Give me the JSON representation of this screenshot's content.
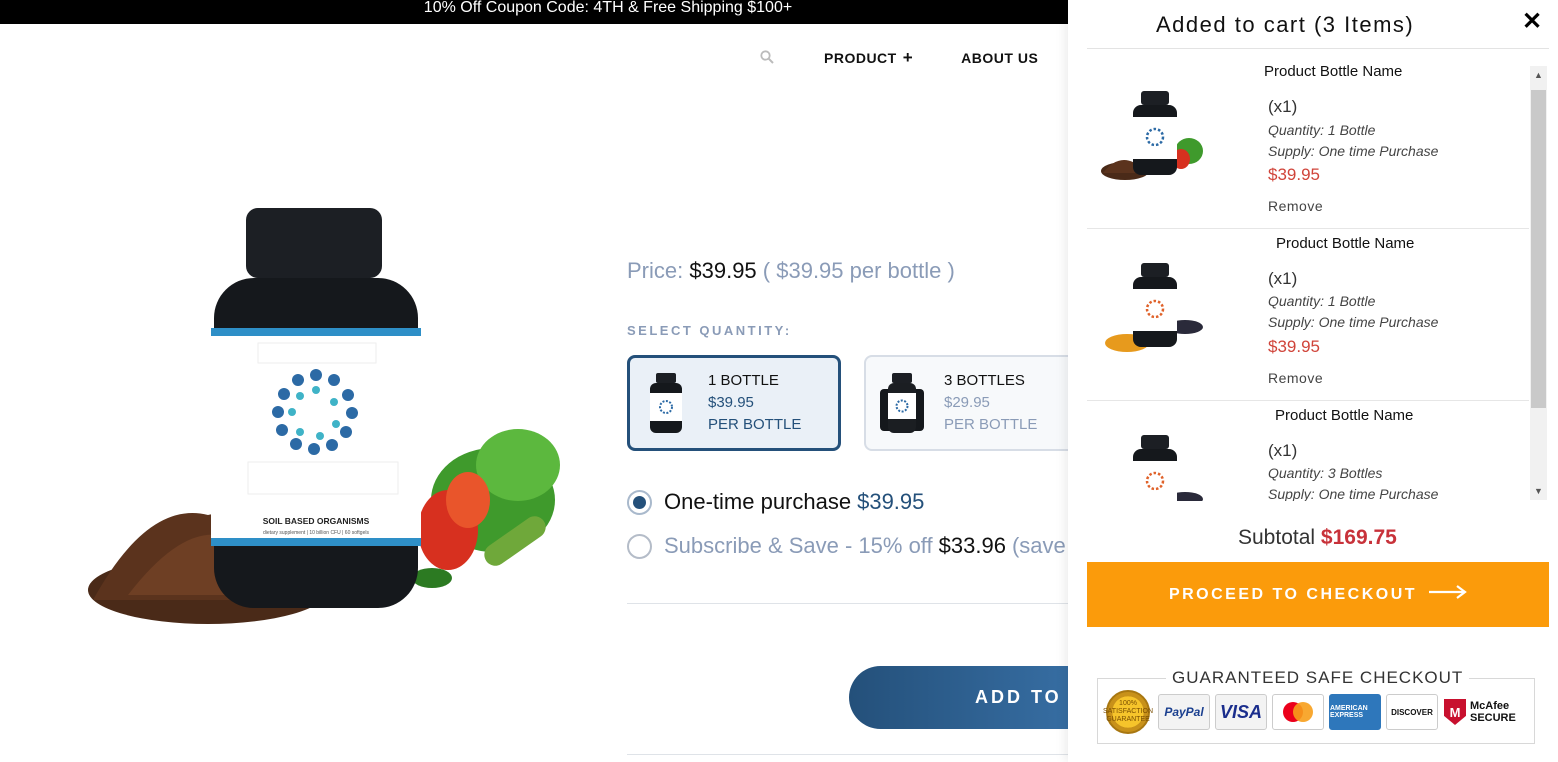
{
  "announcement": "10% Off Coupon Code: 4TH & Free Shipping $100+",
  "nav": {
    "search_icon": "search-icon",
    "items": [
      {
        "label": "PRODUCT",
        "suffix": "+"
      },
      {
        "label": "ABOUT US",
        "suffix": ""
      }
    ]
  },
  "product": {
    "price_label": "Price:",
    "price": "$39.95",
    "per_bottle": "( $39.95 per bottle )",
    "select_quantity_label": "SELECT QUANTITY:",
    "bottle_label": "SOIL BASED ORGANISMS",
    "bottle_sub": "dietary supplement | 10 billion CFU | 60 softgels",
    "options": [
      {
        "qty": "1 BOTTLE",
        "price": "$39.95",
        "unit": "PER BOTTLE",
        "selected": true
      },
      {
        "qty": "3 BOTTLES",
        "price": "$29.95",
        "unit": "PER BOTTLE",
        "selected": false
      }
    ],
    "purchase": {
      "one_time_label": "One-time purchase",
      "one_time_price": "$39.95",
      "subscribe_label": "Subscribe & Save - 15% off",
      "subscribe_price": "$33.96",
      "subscribe_save": "(save $"
    },
    "add_to_cart": "ADD TO"
  },
  "cart": {
    "title": "Added to cart (3 Items)",
    "close_icon": "close-icon",
    "items": [
      {
        "name": "Product Bottle Name",
        "qty_badge": "(x1)",
        "quantity": "Quantity: 1 Bottle",
        "supply": "Supply: One time Purchase",
        "price": "$39.95",
        "remove": "Remove"
      },
      {
        "name": "Product Bottle Name",
        "qty_badge": "(x1)",
        "quantity": "Quantity: 1 Bottle",
        "supply": "Supply: One time Purchase",
        "price": "$39.95",
        "remove": "Remove"
      },
      {
        "name": "Product Bottle Name",
        "qty_badge": "(x1)",
        "quantity": "Quantity: 3 Bottles",
        "supply": "Supply: One time Purchase",
        "price": "",
        "remove": ""
      }
    ],
    "subtotal_label": "Subtotal",
    "subtotal_value": "$169.75",
    "checkout_label": "PROCEED TO CHECKOUT",
    "guarantee_title": "GUARANTEED SAFE CHECKOUT",
    "badges": {
      "seal": "100% SATISFACTION GUARANTEE",
      "paypal": "PayPal",
      "visa": "VISA",
      "mastercard": "MasterCard",
      "amex": "AMERICAN EXPRESS",
      "discover": "DISCOVER",
      "mcafee": "McAfee SECURE"
    }
  },
  "colors": {
    "brand_blue": "#24507a",
    "checkout_orange": "#fb9b0b",
    "price_red": "#d0443a",
    "muted": "#8a9bb7"
  }
}
